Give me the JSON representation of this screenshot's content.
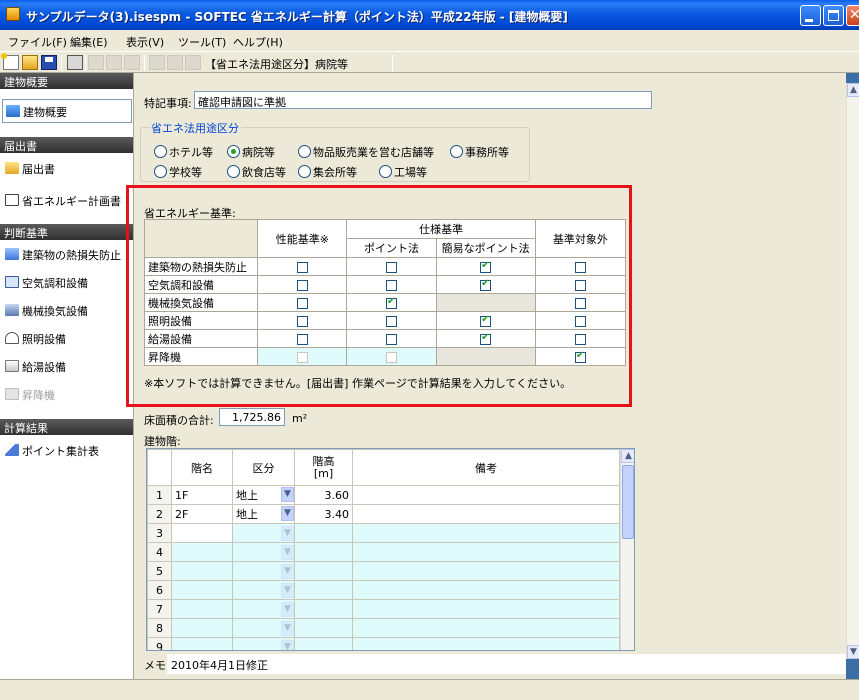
{
  "window": {
    "title": "サンプルデータ(3).isespm - SOFTEC 省エネルギー計算（ポイント法）平成22年版 - [建物概要]",
    "minimize_label": "minimize",
    "maximize_label": "maximize",
    "close_label": "close"
  },
  "menu": [
    "ファイル(F)",
    "編集(E)",
    "表示(V)",
    "ツール(T)",
    "ヘルプ(H)"
  ],
  "toolbar": {
    "icons": [
      "new-file-icon",
      "open-folder-icon",
      "save-icon",
      "print-icon",
      "cut-icon",
      "copy-icon",
      "paste-icon",
      "edit-icon",
      "delete-icon",
      "insert-row-icon"
    ],
    "label": "【省エネ法用途区分】病院等"
  },
  "sidebar": {
    "sections": [
      {
        "header": "建物概要",
        "items": [
          {
            "label": "建物概要",
            "icon": "building-icon",
            "selected": true
          }
        ]
      },
      {
        "header": "届出書",
        "items": [
          {
            "label": "届出書",
            "icon": "folder-icon"
          },
          {
            "label": "省エネルギー計画書",
            "icon": "document-icon"
          }
        ]
      },
      {
        "header": "判断基準",
        "items": [
          {
            "label": "建築物の熱損失防止",
            "icon": "building-insulation-icon"
          },
          {
            "label": "空気調和設備",
            "icon": "air-conditioner-icon"
          },
          {
            "label": "機械換気設備",
            "icon": "ventilation-icon"
          },
          {
            "label": "照明設備",
            "icon": "lighting-icon"
          },
          {
            "label": "給湯設備",
            "icon": "water-heater-icon"
          },
          {
            "label": "昇降機",
            "icon": "elevator-icon",
            "disabled": true
          }
        ]
      },
      {
        "header": "計算結果",
        "items": [
          {
            "label": "ポイント集計表",
            "icon": "chart-icon"
          }
        ]
      }
    ]
  },
  "form": {
    "special_notes_label": "特記事項:",
    "special_notes_value": "確認申請図に準拠",
    "usage_group_title": "省エネ法用途区分",
    "usage_options": [
      {
        "label": "ホテル等",
        "checked": false
      },
      {
        "label": "病院等",
        "checked": true
      },
      {
        "label": "物品販売業を営む店舗等",
        "checked": false
      },
      {
        "label": "事務所等",
        "checked": false
      },
      {
        "label": "学校等",
        "checked": false
      },
      {
        "label": "飲食店等",
        "checked": false
      },
      {
        "label": "集会所等",
        "checked": false
      },
      {
        "label": "工場等",
        "checked": false
      }
    ],
    "standard_title": "省エネルギー基準:",
    "standard_headers": {
      "performance": "性能基準※",
      "spec": "仕様基準",
      "point": "ポイント法",
      "simple_point": "簡易なポイント法",
      "exempt": "基準対象外"
    },
    "standard_rows": [
      {
        "label": "建築物の熱損失防止",
        "perf": false,
        "point": false,
        "simple": true,
        "exempt": false
      },
      {
        "label": "空気調和設備",
        "perf": false,
        "point": false,
        "simple": true,
        "exempt": false
      },
      {
        "label": "機械換気設備",
        "perf": false,
        "point": true,
        "simple": null,
        "exempt": false
      },
      {
        "label": "照明設備",
        "perf": false,
        "point": false,
        "simple": true,
        "exempt": false
      },
      {
        "label": "給湯設備",
        "perf": false,
        "point": false,
        "simple": true,
        "exempt": false
      },
      {
        "label": "昇降機",
        "perf": "disabled",
        "point": "disabled",
        "simple": null,
        "exempt": true
      }
    ],
    "standard_note": "※本ソフトでは計算できません。[届出書] 作業ページで計算結果を入力してください。",
    "floor_area_label": "床面積の合計:",
    "floor_area_value": "1,725.86",
    "floor_area_unit": "m²",
    "floors_label": "建物階:",
    "floors_headers": {
      "name": "階名",
      "category": "区分",
      "height": "階高\n[m]",
      "remarks": "備考"
    },
    "floors": [
      {
        "no": "1",
        "name": "1F",
        "category": "地上",
        "height": "3.60",
        "remarks": ""
      },
      {
        "no": "2",
        "name": "2F",
        "category": "地上",
        "height": "3.40",
        "remarks": ""
      },
      {
        "no": "3",
        "name": "",
        "category": "",
        "height": "",
        "remarks": ""
      },
      {
        "no": "4",
        "name": "",
        "category": "",
        "height": "",
        "remarks": ""
      },
      {
        "no": "5",
        "name": "",
        "category": "",
        "height": "",
        "remarks": ""
      },
      {
        "no": "6",
        "name": "",
        "category": "",
        "height": "",
        "remarks": ""
      },
      {
        "no": "7",
        "name": "",
        "category": "",
        "height": "",
        "remarks": ""
      },
      {
        "no": "8",
        "name": "",
        "category": "",
        "height": "",
        "remarks": ""
      },
      {
        "no": "9",
        "name": "",
        "category": "",
        "height": "",
        "remarks": ""
      }
    ],
    "memo_label": "メモ:",
    "memo_value": "2010年4月1日修正"
  },
  "colors": {
    "titlebar": "#0a59e0",
    "highlight": "#e5121a",
    "check": "#21a121",
    "cell_cyan": "#e0fbfc"
  }
}
